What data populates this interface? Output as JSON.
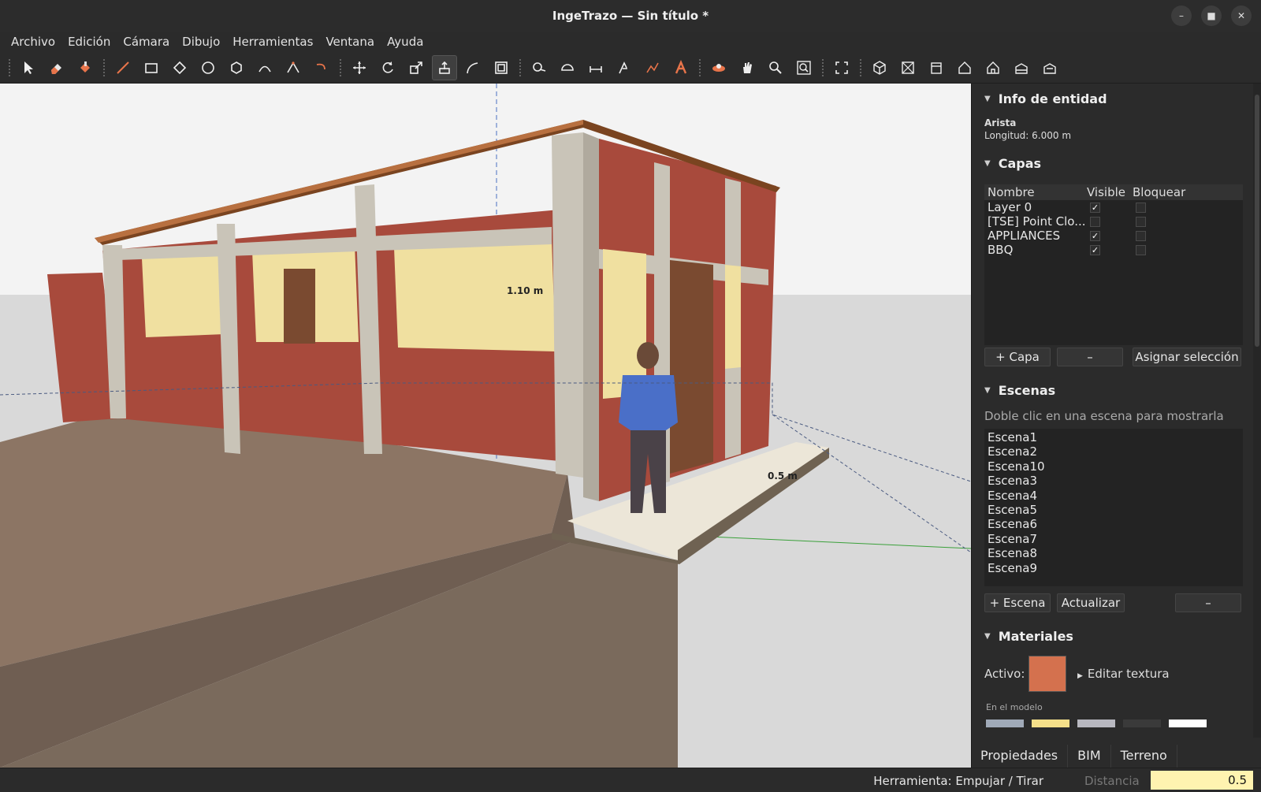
{
  "window": {
    "title": "IngeTrazo — Sin título *"
  },
  "menu": [
    "Archivo",
    "Edición",
    "Cámara",
    "Dibujo",
    "Herramientas",
    "Ventana",
    "Ayuda"
  ],
  "viewport": {
    "dim1": "1.10 m",
    "dim2": "0.5 m"
  },
  "entity_info": {
    "header": "Info de entidad",
    "type": "Arista",
    "length": "Longitud: 6.000 m"
  },
  "layers": {
    "header": "Capas",
    "columns": [
      "Nombre",
      "Visible",
      "Bloquear"
    ],
    "rows": [
      {
        "name": "Layer 0",
        "visible": true,
        "locked": false
      },
      {
        "name": "[TSE] Point Clo...",
        "visible": false,
        "locked": false
      },
      {
        "name": "APPLIANCES",
        "visible": true,
        "locked": false
      },
      {
        "name": "BBQ",
        "visible": true,
        "locked": false
      }
    ],
    "add_button": "+ Capa",
    "remove_button": "–",
    "assign_button": "Asignar selección"
  },
  "scenes": {
    "header": "Escenas",
    "hint": "Doble clic en una escena para mostrarla",
    "items": [
      "Escena1",
      "Escena2",
      "Escena10",
      "Escena3",
      "Escena4",
      "Escena5",
      "Escena6",
      "Escena7",
      "Escena8",
      "Escena9"
    ],
    "add_button": "+ Escena",
    "update_button": "Actualizar",
    "remove_button": "–"
  },
  "materials": {
    "header": "Materiales",
    "active_label": "Activo:",
    "active_color": "#d4714e",
    "edit_texture": "Editar textura",
    "in_model": "En el modelo",
    "swatches": [
      "#a0aab8",
      "#f5e08a",
      "#b8b8c0",
      "#3a3a3a",
      "#ffffff"
    ]
  },
  "tabs": [
    "Propiedades",
    "BIM",
    "Terreno"
  ],
  "status": {
    "tool": "Herramienta: Empujar / Tirar",
    "distance_label": "Distancia",
    "distance_value": "0.5"
  }
}
